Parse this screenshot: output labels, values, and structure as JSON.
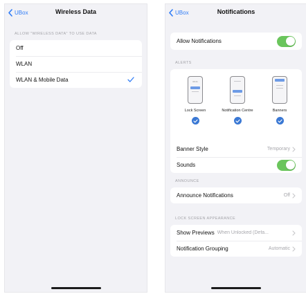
{
  "colors": {
    "accent": "#2f7cf6",
    "toggle_on": "#6ac55c",
    "radio_fill": "#3a78d4"
  },
  "left_screen": {
    "back_label": "UBox",
    "title": "Wireless Data",
    "section_header": "Allow \"Wireless Data\" to Use Data",
    "options": [
      {
        "label": "Off",
        "selected": false
      },
      {
        "label": "WLAN",
        "selected": false
      },
      {
        "label": "WLAN & Mobile Data",
        "selected": true
      }
    ]
  },
  "right_screen": {
    "back_label": "UBox",
    "title": "Notifications",
    "allow_notifications": {
      "label": "Allow Notifications",
      "on": true
    },
    "alerts_header": "Alerts",
    "alert_styles": [
      {
        "label": "Lock Screen",
        "icon": "lock-screen-phone-icon",
        "checked": true,
        "clock": "09:41"
      },
      {
        "label": "Notification Centre",
        "icon": "notification-centre-phone-icon",
        "checked": true
      },
      {
        "label": "Banners",
        "icon": "banners-phone-icon",
        "checked": true
      }
    ],
    "banner_style": {
      "label": "Banner Style",
      "value": "Temporary"
    },
    "sounds": {
      "label": "Sounds",
      "on": true
    },
    "announce_header": "Announce",
    "announce_notifications": {
      "label": "Announce Notifications",
      "value": "Off"
    },
    "lock_screen_header": "Lock Screen Appearance",
    "show_previews": {
      "label": "Show Previews",
      "value": "When Unlocked (Defa..."
    },
    "notification_grouping": {
      "label": "Notification Grouping",
      "value": "Automatic"
    }
  }
}
